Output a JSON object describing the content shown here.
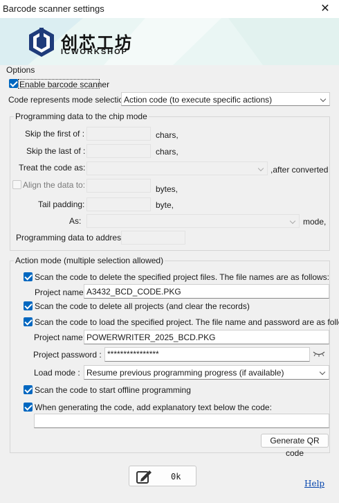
{
  "window": {
    "title": "Barcode scanner settings"
  },
  "banner": {
    "brand_cn": "创芯工坊",
    "brand_en": "ICWORKSHOP"
  },
  "options": {
    "group_title": "Options",
    "enable_label": "Enable barcode scanner",
    "enable_checked": true,
    "mode_label": "Code represents mode selection:",
    "mode_value": "Action code (to execute specific actions)"
  },
  "programming": {
    "group_title": "Programming data to the chip mode",
    "skip_first_label": "Skip the first of :",
    "skip_first_unit": "chars,",
    "skip_last_label": "Skip the last of :",
    "skip_last_unit": "chars,",
    "treat_label": "Treat the code as:",
    "treat_suffix": ",after converted",
    "align_label": "Align the data to:",
    "align_checked": false,
    "align_unit": "bytes,",
    "tail_label": "Tail padding:",
    "tail_unit": "byte,",
    "as_label": "As:",
    "as_suffix": "mode,",
    "address_label": "Programming data to address:"
  },
  "action": {
    "group_title": "Action mode (multiple selection allowed)",
    "delete_files_label": "Scan the code to delete the specified project files. The file names are as follows:",
    "delete_files_checked": true,
    "delete_project_name_label": "Project name:",
    "delete_project_name_value": "A3432_BCD_CODE.PKG",
    "delete_all_label": "Scan the code to delete all projects (and clear the records)",
    "delete_all_checked": true,
    "load_label": "Scan the code to load the specified project. The file name and password are as follows:",
    "load_checked": true,
    "load_project_name_label": "Project name:",
    "load_project_name_value": "POWERWRITER_2025_BCD.PKG",
    "password_label": "Project password :",
    "password_value": "****************",
    "load_mode_label": "Load mode :",
    "load_mode_value": "Resume previous programming progress (if available)",
    "offline_label": "Scan the code to start offline programming",
    "offline_checked": true,
    "explain_label": "When generating the code, add explanatory text below the code:",
    "explain_checked": true,
    "explain_value": "",
    "generate_button": "Generate QR code"
  },
  "footer": {
    "ok_label": "0k",
    "help_label": "Help"
  }
}
